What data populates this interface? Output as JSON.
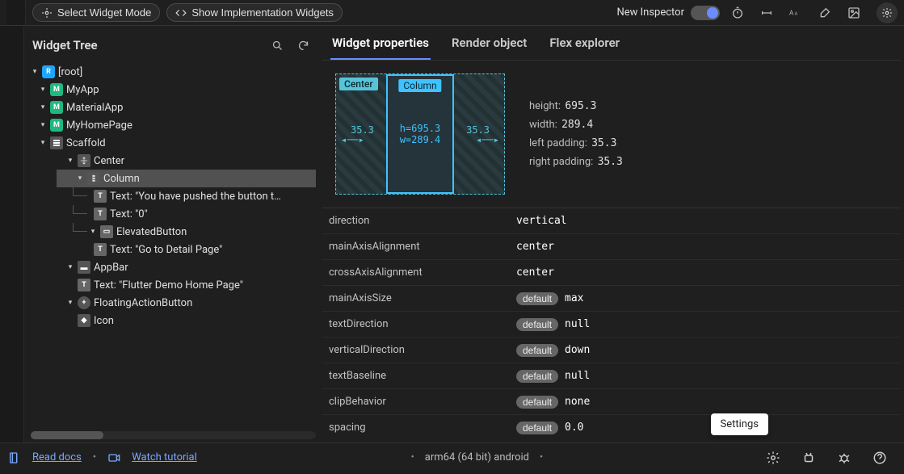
{
  "toolbar": {
    "select_mode": "Select Widget Mode",
    "show_impl": "Show Implementation Widgets",
    "new_inspector": "New Inspector"
  },
  "tree": {
    "title": "Widget Tree",
    "nodes": {
      "root": "[root]",
      "myapp": "MyApp",
      "materialapp": "MaterialApp",
      "myhomepage": "MyHomePage",
      "scaffold": "Scaffold",
      "center": "Center",
      "column": "Column",
      "text1": "Text: \"You have pushed the button t…",
      "text2": "Text: \"0\"",
      "elevated": "ElevatedButton",
      "text3": "Text: \"Go to Detail Page\"",
      "appbar": "AppBar",
      "text4": "Text: \"Flutter Demo Home Page\"",
      "fab": "FloatingActionButton",
      "icon": "Icon"
    }
  },
  "tabs": {
    "widget_props": "Widget properties",
    "render_obj": "Render object",
    "flex_explorer": "Flex explorer"
  },
  "boxmodel": {
    "outer_label": "Center",
    "inner_label": "Column",
    "pad_left": "35.3",
    "pad_right": "35.3",
    "h": "h=695.3",
    "w": "w=289.4"
  },
  "dims": {
    "height_k": "height: ",
    "height_v": "695.3",
    "width_k": "width: ",
    "width_v": "289.4",
    "lpad_k": "left padding: ",
    "lpad_v": "35.3",
    "rpad_k": "right padding: ",
    "rpad_v": "35.3"
  },
  "props": [
    {
      "k": "direction",
      "default": false,
      "v": "vertical"
    },
    {
      "k": "mainAxisAlignment",
      "default": false,
      "v": "center"
    },
    {
      "k": "crossAxisAlignment",
      "default": false,
      "v": "center"
    },
    {
      "k": "mainAxisSize",
      "default": true,
      "v": "max"
    },
    {
      "k": "textDirection",
      "default": true,
      "v": "null"
    },
    {
      "k": "verticalDirection",
      "default": true,
      "v": "down"
    },
    {
      "k": "textBaseline",
      "default": true,
      "v": "null"
    },
    {
      "k": "clipBehavior",
      "default": true,
      "v": "none"
    },
    {
      "k": "spacing",
      "default": true,
      "v": "0.0"
    }
  ],
  "default_label": "default",
  "footer": {
    "read_docs": "Read docs",
    "watch": "Watch tutorial",
    "target": "arm64 (64 bit) android",
    "tooltip": "Settings"
  }
}
